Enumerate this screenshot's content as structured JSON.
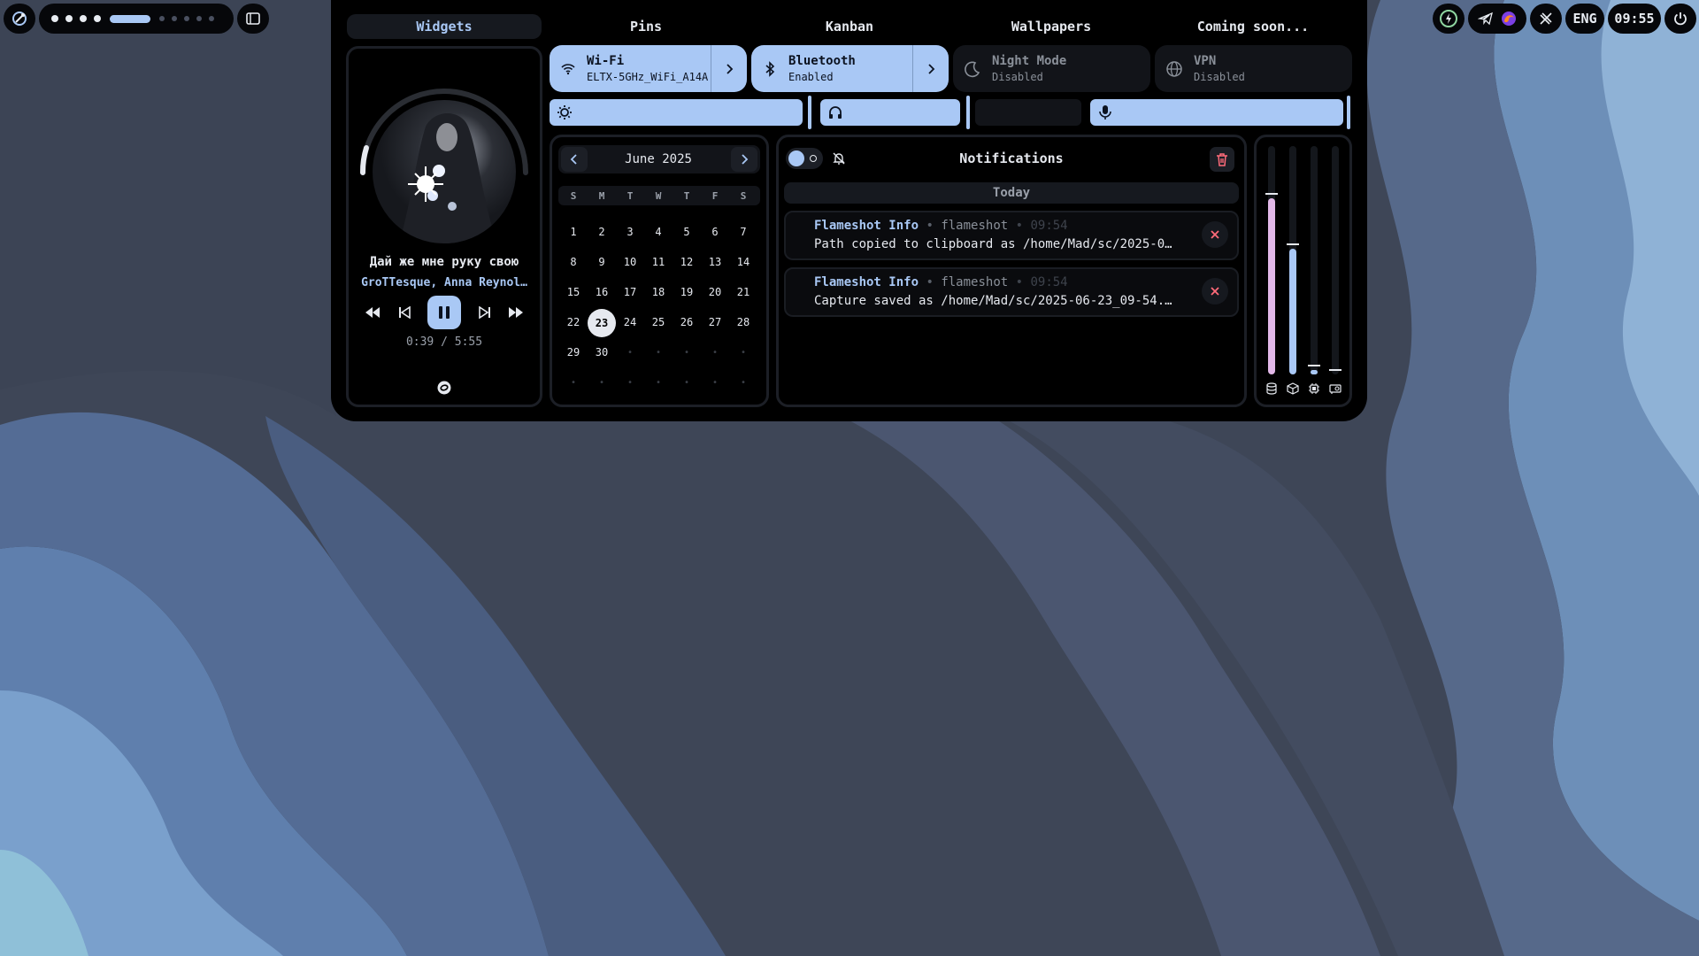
{
  "colors": {
    "accent": "#a9c8f5",
    "panel": "#000000",
    "danger": "#ff6b7a",
    "lavender": "#e2b8e8"
  },
  "topbar": {
    "left_icon": "arch-launcher-icon",
    "workspaces": {
      "filled": 4,
      "active": 1,
      "empty": 5
    },
    "overview_icon": "window-overview-icon",
    "tray_icons": [
      "power-profile-icon",
      "telegram-icon",
      "firefox-icon",
      "tools-icon"
    ],
    "keyboard_layout": "ENG",
    "clock": "09:55",
    "power_icon": "power-icon"
  },
  "tabs": [
    {
      "label": "Widgets",
      "active": true
    },
    {
      "label": "Pins",
      "active": false
    },
    {
      "label": "Kanban",
      "active": false
    },
    {
      "label": "Wallpapers",
      "active": false
    },
    {
      "label": "Coming soon...",
      "active": false
    }
  ],
  "toggles": [
    {
      "title": "Wi-Fi",
      "subtitle": "ELTX-5GHz_WiFi_A14A",
      "on": true,
      "icon": "wifi-icon"
    },
    {
      "title": "Bluetooth",
      "subtitle": "Enabled",
      "on": true,
      "icon": "bluetooth-icon"
    },
    {
      "title": "Night Mode",
      "subtitle": "Disabled",
      "on": false,
      "icon": "moon-icon"
    },
    {
      "title": "VPN",
      "subtitle": "Disabled",
      "on": false,
      "icon": "globe-icon"
    }
  ],
  "sliders": [
    {
      "name": "brightness",
      "icon": "brightness-icon",
      "level": 1.0
    },
    {
      "name": "headphones-volume",
      "icon": "headphones-icon",
      "level": 1.0
    },
    {
      "name": "other",
      "icon": "",
      "level": 0.0
    },
    {
      "name": "microphone",
      "icon": "mic-icon",
      "level": 1.0
    }
  ],
  "player": {
    "title": "Дай же мне руку свою",
    "artist": "GroTTesque, Anna Reynol…",
    "time": "0:39 / 5:55",
    "progress": 0.11,
    "source_icon": "music-source-icon"
  },
  "calendar": {
    "month": "June 2025",
    "weekdays": [
      "S",
      "M",
      "T",
      "W",
      "T",
      "F",
      "S"
    ],
    "weeks": [
      [
        "1",
        "2",
        "3",
        "4",
        "5",
        "6",
        "7"
      ],
      [
        "8",
        "9",
        "10",
        "11",
        "12",
        "13",
        "14"
      ],
      [
        "15",
        "16",
        "17",
        "18",
        "19",
        "20",
        "21"
      ],
      [
        "22",
        "23",
        "24",
        "25",
        "26",
        "27",
        "28"
      ],
      [
        "29",
        "30",
        "•",
        "•",
        "•",
        "•",
        "•"
      ],
      [
        "•",
        "•",
        "•",
        "•",
        "•",
        "•",
        "•"
      ]
    ],
    "today": "23"
  },
  "notifications": {
    "title": "Notifications",
    "group": "Today",
    "items": [
      {
        "app": "Flameshot Info",
        "source": "flameshot",
        "time": "09:54",
        "body": "Path copied to clipboard as /home/Mad/sc/2025-0…"
      },
      {
        "app": "Flameshot Info",
        "source": "flameshot",
        "time": "09:54",
        "body": "Capture saved as /home/Mad/sc/2025-06-23_09-54.…"
      }
    ]
  },
  "resources": [
    {
      "name": "ram",
      "icon": "database-icon",
      "level": 0.77,
      "color": "#e2b8e8"
    },
    {
      "name": "swap",
      "icon": "cube-icon",
      "level": 0.55,
      "color": "#a9c8f5"
    },
    {
      "name": "cpu",
      "icon": "cpu-icon",
      "level": 0.02,
      "color": "#a9c8f5"
    },
    {
      "name": "gpu",
      "icon": "gpu-icon",
      "level": 0.0,
      "color": "#a9c8f5"
    }
  ]
}
